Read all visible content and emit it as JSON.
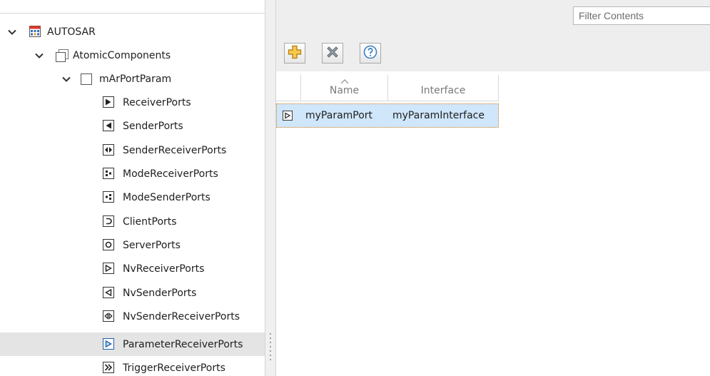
{
  "tree": {
    "items": [
      {
        "label": "AUTOSAR",
        "level": 0,
        "expanded": true,
        "icon": "autosar-package-icon"
      },
      {
        "label": "AtomicComponents",
        "level": 1,
        "expanded": true,
        "icon": "component-group-icon"
      },
      {
        "label": "mArPortParam",
        "level": 2,
        "expanded": true,
        "icon": "component-icon"
      },
      {
        "label": "ReceiverPorts",
        "level": 3,
        "icon": "receiver-port-icon"
      },
      {
        "label": "SenderPorts",
        "level": 3,
        "icon": "sender-port-icon"
      },
      {
        "label": "SenderReceiverPorts",
        "level": 3,
        "icon": "sender-receiver-port-icon"
      },
      {
        "label": "ModeReceiverPorts",
        "level": 3,
        "icon": "mode-receiver-port-icon"
      },
      {
        "label": "ModeSenderPorts",
        "level": 3,
        "icon": "mode-sender-port-icon"
      },
      {
        "label": "ClientPorts",
        "level": 3,
        "icon": "client-port-icon"
      },
      {
        "label": "ServerPorts",
        "level": 3,
        "icon": "server-port-icon"
      },
      {
        "label": "NvReceiverPorts",
        "level": 3,
        "icon": "nv-receiver-port-icon"
      },
      {
        "label": "NvSenderPorts",
        "level": 3,
        "icon": "nv-sender-port-icon"
      },
      {
        "label": "NvSenderReceiverPorts",
        "level": 3,
        "icon": "nv-sender-receiver-port-icon"
      },
      {
        "label": "ParameterReceiverPorts",
        "level": 3,
        "icon": "parameter-receiver-port-icon",
        "selected": true
      },
      {
        "label": "TriggerReceiverPorts",
        "level": 3,
        "icon": "trigger-receiver-port-icon"
      }
    ]
  },
  "filter": {
    "placeholder": "Filter Contents"
  },
  "toolbar": {
    "add_icon": "add-icon",
    "delete_icon": "delete-icon",
    "help_icon": "help-icon"
  },
  "table": {
    "columns": [
      {
        "label": "Name",
        "sorted": true
      },
      {
        "label": "Interface"
      }
    ],
    "rows": [
      {
        "name": "myParamPort",
        "interface": "myParamInterface",
        "selected": true
      }
    ]
  },
  "colors": {
    "selection_row": "#cfe6fb",
    "selection_border": "#e3821b",
    "tree_selected": "#e4e4e4",
    "toolbar_bg": "#eeeeee",
    "add_icon_fill": "#f7c948",
    "delete_icon_fill": "#9aa3ad",
    "help_icon_fill": "#3f7fc1"
  }
}
